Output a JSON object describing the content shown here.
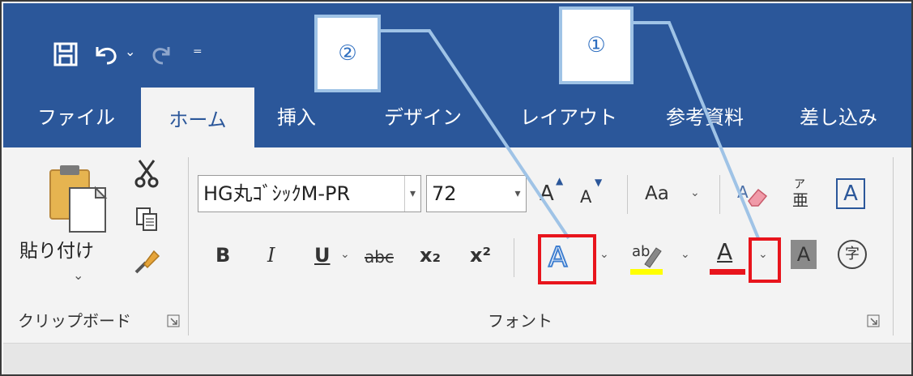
{
  "quick_access": {
    "save_icon": "save-icon",
    "undo_icon": "undo-icon",
    "redo_icon": "redo-icon",
    "customize_icon": "customize-qat-icon",
    "undo_dropdown": "⌄",
    "customize_glyph": "₌"
  },
  "tabs": {
    "file": "ファイル",
    "home": "ホーム",
    "insert": "挿入",
    "design": "デザイン",
    "layout": "レイアウト",
    "references": "参考資料",
    "mailings": "差し込み"
  },
  "clipboard": {
    "paste_label": "貼り付け",
    "paste_arrow": "⌄",
    "group_label": "クリップボード"
  },
  "font": {
    "font_name": "HG丸ｺﾞｼｯｸM-PR",
    "font_size": "72",
    "grow": "A",
    "shrink": "A",
    "change_case": "Aa",
    "bold": "B",
    "italic": "I",
    "underline": "U",
    "strikethrough": "abc",
    "subscript": "x₂",
    "superscript": "x²",
    "text_effects": "A",
    "highlight": "ab",
    "font_color": "A",
    "char_shading": "A",
    "enclose_char": "字",
    "phonetic": "亜",
    "char_border": "A",
    "group_label": "フォント"
  },
  "callouts": {
    "one": "①",
    "two": "②"
  },
  "colors": {
    "ribbon_blue": "#2b579a",
    "highlight_yellow": "#ffff00",
    "font_red": "#e8141c",
    "callout_border": "#9fc3e6",
    "callout_text": "#2f6fc0"
  }
}
